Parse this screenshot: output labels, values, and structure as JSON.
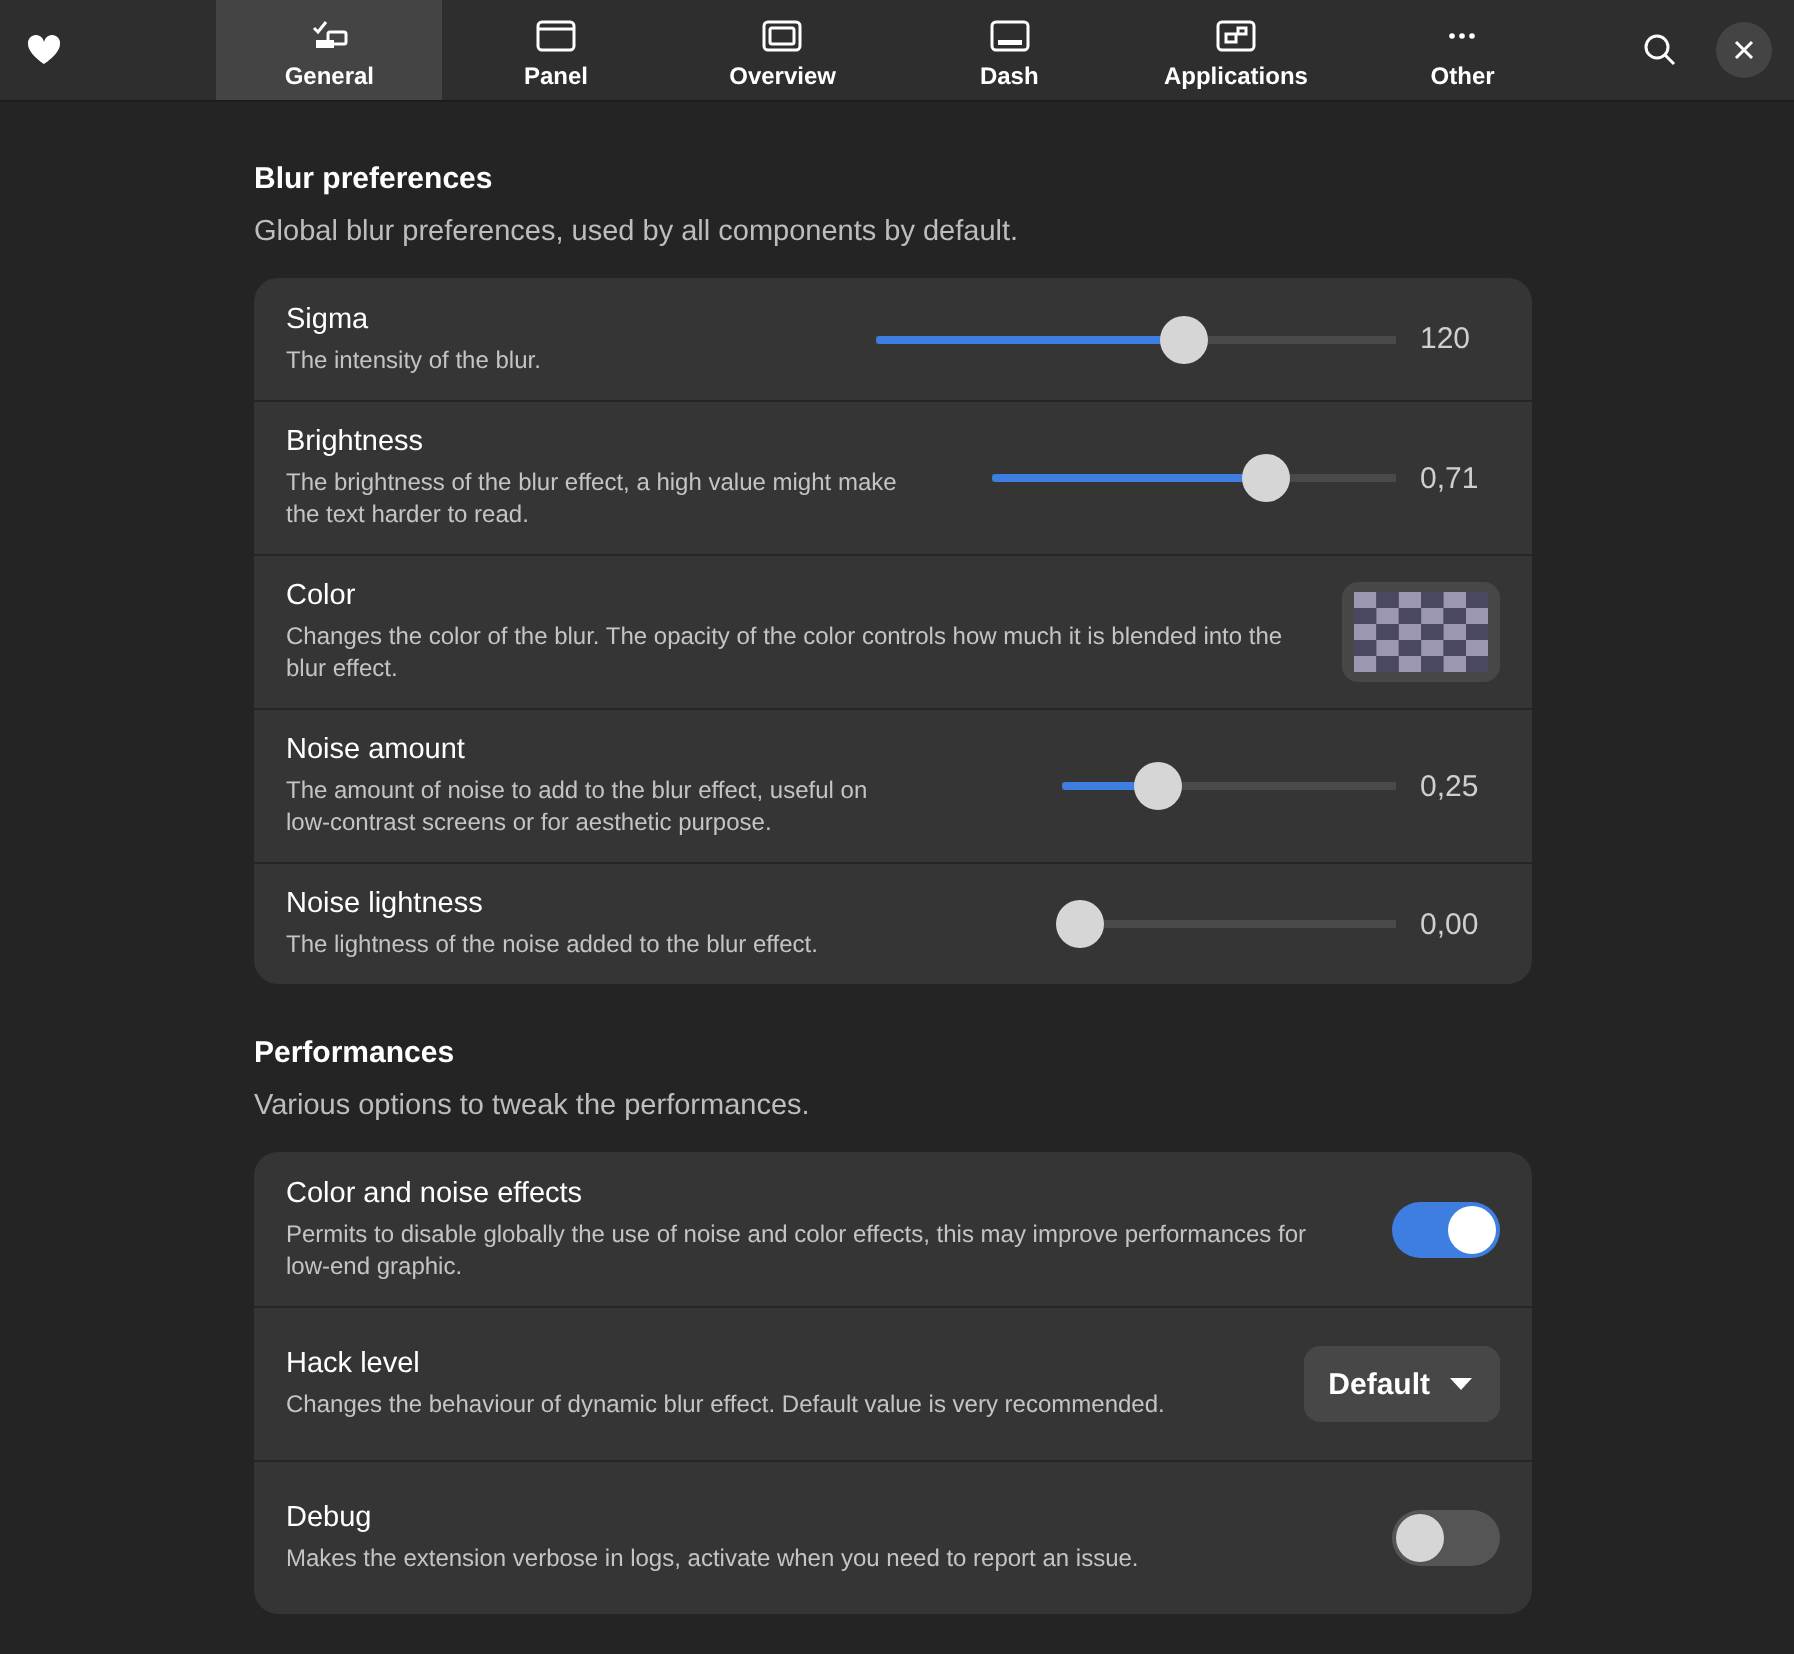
{
  "header": {
    "tabs": [
      {
        "label": "General",
        "selected": true
      },
      {
        "label": "Panel",
        "selected": false
      },
      {
        "label": "Overview",
        "selected": false
      },
      {
        "label": "Dash",
        "selected": false
      },
      {
        "label": "Applications",
        "selected": false
      },
      {
        "label": "Other",
        "selected": false
      }
    ]
  },
  "sections": [
    {
      "title": "Blur preferences",
      "subtitle": "Global blur preferences, used by all components by default.",
      "rows": [
        {
          "kind": "slider",
          "title": "Sigma",
          "description": "The intensity of the blur.",
          "level": 0.6,
          "reading": "120"
        },
        {
          "kind": "slider",
          "title": "Brightness",
          "description": "The brightness of the blur effect, a high value might make the text harder to read.",
          "level": 0.7,
          "reading": "0,71"
        },
        {
          "kind": "color",
          "title": "Color",
          "description": "Changes the color of the blur. The opacity of the color controls how much it is blended into the blur effect."
        },
        {
          "kind": "slider",
          "title": "Noise amount",
          "description": "The amount of noise to add to the blur effect, useful on low-contrast screens or for aesthetic purpose.",
          "level": 0.25,
          "reading": "0,25"
        },
        {
          "kind": "slider",
          "title": "Noise lightness",
          "description": "The lightness of the noise added to the blur effect.",
          "level": 0,
          "reading": "0,00"
        }
      ]
    },
    {
      "title": "Performances",
      "subtitle": "Various options to tweak the performances.",
      "rows": [
        {
          "kind": "switch",
          "title": "Color and noise effects",
          "description": "Permits to disable globally the use of noise and color effects, this may improve performances for low-end graphic.",
          "on": true
        },
        {
          "kind": "dropdown",
          "title": "Hack level",
          "description": "Changes the behaviour of dynamic blur effect. Default value is very recommended.",
          "value": "Default"
        },
        {
          "kind": "switch",
          "title": "Debug",
          "description": "Makes the extension verbose in logs, activate when you need to report an issue.",
          "on": false
        }
      ]
    }
  ]
}
